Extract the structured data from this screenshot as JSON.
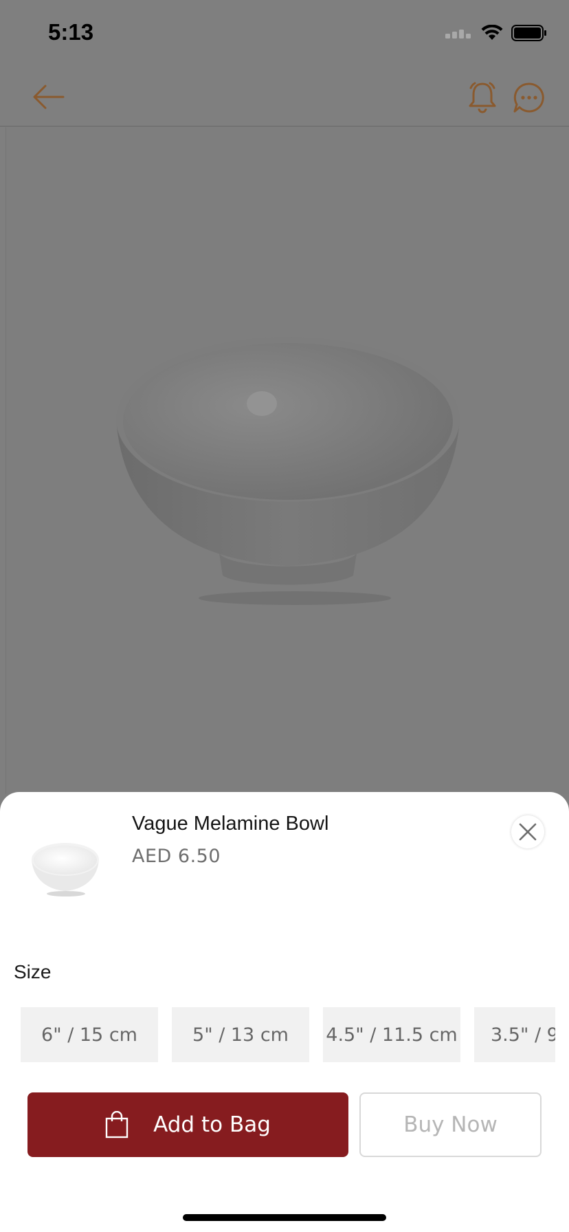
{
  "status_bar": {
    "time": "5:13",
    "icons": [
      "signal-icon",
      "wifi-icon",
      "battery-icon"
    ]
  },
  "header": {
    "icons": [
      "back-arrow-icon",
      "bell-icon",
      "chat-icon"
    ],
    "accent_color": "#8a5a2e"
  },
  "product": {
    "name": "Vague Melamine Bowl",
    "price": "AED 6.50"
  },
  "size_selector": {
    "label": "Size",
    "options": [
      "6\" / 15 cm",
      "5\" / 13 cm",
      "4.5\" / 11.5 cm",
      "3.5\" / 9"
    ]
  },
  "actions": {
    "add_to_bag": "Add to Bag",
    "buy_now": "Buy Now",
    "primary_color": "#861c1f"
  }
}
